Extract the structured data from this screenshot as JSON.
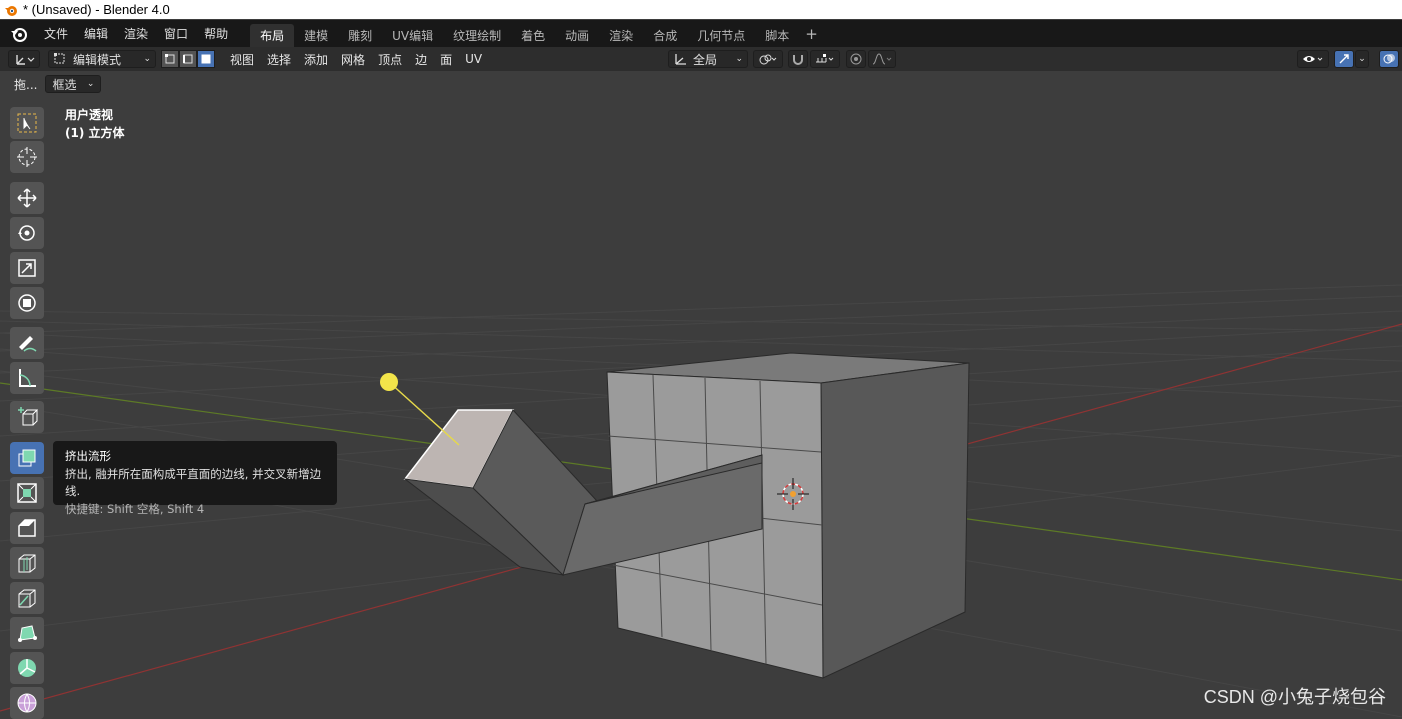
{
  "window": {
    "title": "* (Unsaved) - Blender 4.0"
  },
  "menubar": {
    "items": [
      "文件",
      "编辑",
      "渲染",
      "窗口",
      "帮助"
    ]
  },
  "workspaces": {
    "tabs": [
      "布局",
      "建模",
      "雕刻",
      "UV编辑",
      "纹理绘制",
      "着色",
      "动画",
      "渲染",
      "合成",
      "几何节点",
      "脚本"
    ],
    "active_index": 0,
    "add_label": "+"
  },
  "header": {
    "mode": "编辑模式",
    "menus": [
      "视图",
      "选择",
      "添加",
      "网格",
      "顶点",
      "边",
      "面",
      "UV"
    ],
    "transform_orientation": "全局"
  },
  "tool_options": {
    "drag_label": "拖...",
    "select_mode": "框选"
  },
  "viewport": {
    "view_name": "用户透视",
    "object_name": "(1) 立方体"
  },
  "toolbar": {
    "tools": [
      "select-box",
      "cursor",
      "move",
      "rotate",
      "scale",
      "transform",
      "annotate",
      "measure",
      "add-cube",
      "extrude-manifold",
      "inset-faces",
      "bevel",
      "loop-cut",
      "knife",
      "poly-build",
      "spin",
      "smooth"
    ],
    "active_tool": "extrude-manifold"
  },
  "tooltip": {
    "title": "挤出流形",
    "description": "挤出, 融并所在面构成平直面的边线, 并交叉新增边线.",
    "shortcut": "快捷键: Shift 空格, Shift 4"
  },
  "watermark": "CSDN @小兔子烧包谷",
  "colors": {
    "accent": "#4772b3",
    "viewport_bg": "#3d3d3d",
    "x_axis": "#9a3a3a",
    "y_axis": "#6a8a2a",
    "tool_green": "#7fd8b0"
  }
}
